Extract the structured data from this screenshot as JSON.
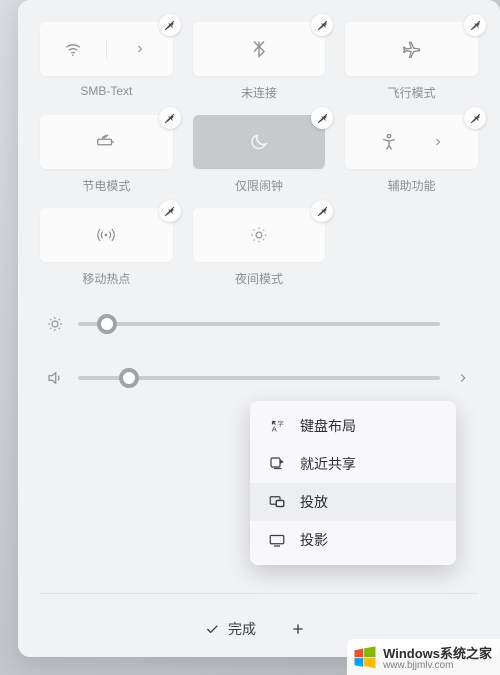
{
  "tiles": [
    {
      "id": "wifi",
      "label": "SMB-Text",
      "icon": "wifi",
      "split": true,
      "active": false
    },
    {
      "id": "bluetooth",
      "label": "未连接",
      "icon": "bluetooth",
      "split": false,
      "active": false
    },
    {
      "id": "airplane",
      "label": "飞行模式",
      "icon": "airplane",
      "split": false,
      "active": false
    },
    {
      "id": "battery",
      "label": "节电模式",
      "icon": "battery-saver",
      "split": false,
      "active": false
    },
    {
      "id": "focus",
      "label": "仅限闹钟",
      "icon": "moon",
      "split": false,
      "active": true
    },
    {
      "id": "a11y",
      "label": "辅助功能",
      "icon": "accessibility",
      "split": true,
      "active": false
    },
    {
      "id": "hotspot",
      "label": "移动热点",
      "icon": "hotspot",
      "split": false,
      "active": false
    },
    {
      "id": "nightlight",
      "label": "夜间模式",
      "icon": "night-light",
      "split": false,
      "active": false
    }
  ],
  "sliders": {
    "brightness": {
      "value": 8,
      "max": 100,
      "icon": "sun",
      "hasChevron": true
    },
    "volume": {
      "value": 14,
      "max": 100,
      "icon": "speaker",
      "hasChevron": true
    }
  },
  "popup": {
    "items": [
      {
        "id": "keyboard",
        "label": "键盘布局",
        "icon": "keyboard-layout",
        "selected": false
      },
      {
        "id": "nearby",
        "label": "就近共享",
        "icon": "nearby-share",
        "selected": false
      },
      {
        "id": "cast",
        "label": "投放",
        "icon": "cast",
        "selected": true
      },
      {
        "id": "project",
        "label": "投影",
        "icon": "project",
        "selected": false
      }
    ]
  },
  "bottom": {
    "done": "完成",
    "add": ""
  },
  "watermark": {
    "main": "Windows系统之家",
    "sub": "www.bjjmlv.com"
  }
}
